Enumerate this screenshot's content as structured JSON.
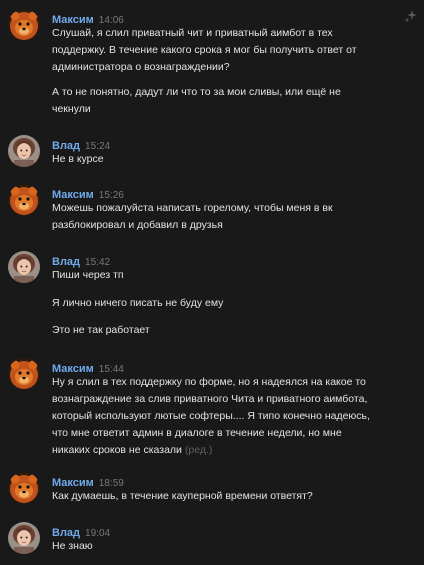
{
  "colors": {
    "background": "#19191a",
    "name": "#71aaeb",
    "time": "#76787a",
    "text": "#e1e3e6",
    "edited": "#5d5f61"
  },
  "top_action_icon": "sparkle-icon",
  "messages": [
    {
      "author": "Максим",
      "avatar_icon": "bear-avatar",
      "time": "14:06",
      "paragraphs": [
        "Слушай, я слил приватный чит и приватный аимбот в тех\nподдержку. В течение какого срока я мог бы получить ответ от\nадминистратора о вознаграждении?",
        "А то не понятно, дадут ли что то за мои сливы, или ещё не\nчекнули"
      ]
    },
    {
      "author": "Влад",
      "avatar_icon": "girl-avatar",
      "time": "15:24",
      "paragraphs": [
        "Не в курсе"
      ]
    },
    {
      "author": "Максим",
      "avatar_icon": "bear-avatar",
      "time": "15:26",
      "paragraphs": [
        "Можешь пожалуйста написать горелому, чтобы меня в вк\nразблокировал и добавил в друзья"
      ]
    },
    {
      "author": "Влад",
      "avatar_icon": "girl-avatar",
      "time": "15:42",
      "paragraphs": [
        "Пиши через тп",
        "Я лично ничего писать не буду ему",
        "Это не так работает"
      ]
    },
    {
      "author": "Максим",
      "avatar_icon": "bear-avatar",
      "time": "15:44",
      "paragraphs": [
        "Ну я слил в тех поддержку по форме, но я надеялся на какое то\nвознаграждение за слив приватного Чита и приватного аимбота,\nкоторый используют лютые софтеры.... Я типо конечно надеюсь,\nчто мне ответит админ в диалоге в течение недели, но мне\nникаких сроков не сказали"
      ],
      "edited_label": "(ред.)"
    },
    {
      "author": "Максим",
      "avatar_icon": "bear-avatar",
      "time": "18:59",
      "paragraphs": [
        "Как думаешь, в течение кауперной времени ответят?"
      ]
    },
    {
      "author": "Влад",
      "avatar_icon": "girl-avatar",
      "time": "19:04",
      "paragraphs": [
        "Не знаю"
      ]
    }
  ]
}
